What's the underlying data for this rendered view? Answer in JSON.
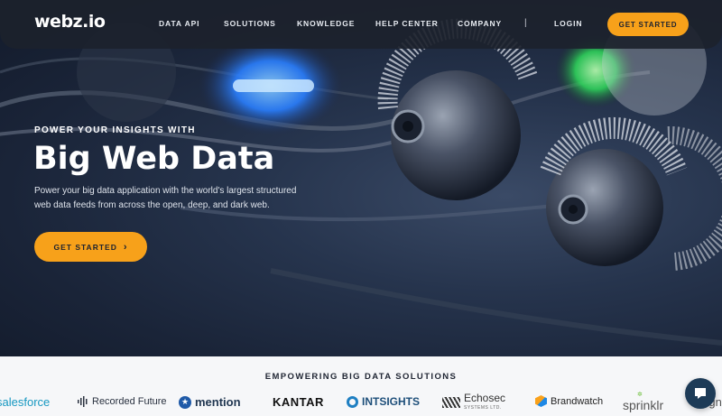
{
  "brand": {
    "logo_text": "webz.io"
  },
  "nav": {
    "items": [
      {
        "label": "DATA API"
      },
      {
        "label": "SOLUTIONS"
      },
      {
        "label": "KNOWLEDGE"
      },
      {
        "label": "HELP CENTER"
      },
      {
        "label": "COMPANY"
      }
    ],
    "separator": "|",
    "login_label": "LOGIN",
    "cta_label": "GET STARTED"
  },
  "hero": {
    "eyebrow": "POWER YOUR INSIGHTS WITH",
    "headline": "Big Web Data",
    "description": "Power your big data application with the world's largest structured web data feeds from across the open, deep, and dark web.",
    "cta_label": "GET STARTED",
    "cta_icon": "chevron-right-icon"
  },
  "clients": {
    "title": "EMPOWERING BIG DATA SOLUTIONS",
    "logos": [
      {
        "name": "salesforce"
      },
      {
        "name": "Recorded Future"
      },
      {
        "name": "mention"
      },
      {
        "name": "KANTAR"
      },
      {
        "name": "INTSIGHTS"
      },
      {
        "name": "Echosec"
      },
      {
        "name": "Brandwatch"
      },
      {
        "name": "sprinklr"
      },
      {
        "name": "signa"
      }
    ],
    "echosec_sub": "SYSTEMS LTD."
  },
  "chat": {
    "icon": "chat-bubble-icon"
  },
  "colors": {
    "accent": "#f7a11a",
    "nav_bg": "#1c222c",
    "hero_bg": "#1a2438",
    "chat_bg": "#1d3b57"
  }
}
